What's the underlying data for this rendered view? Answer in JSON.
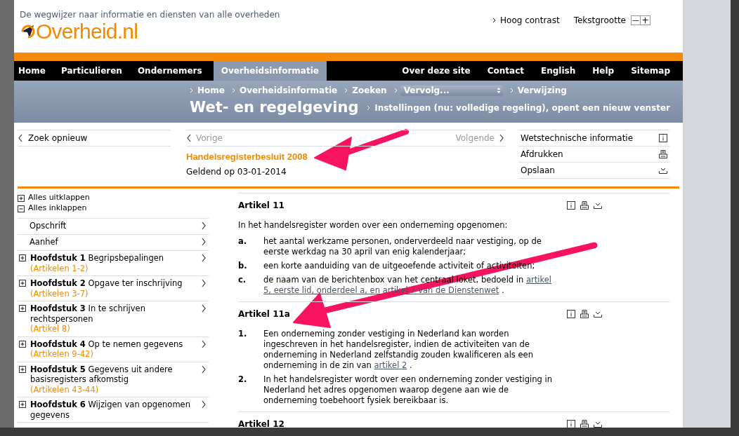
{
  "header": {
    "tagline": "De wegwijzer naar informatie en diensten van alle overheden",
    "logo": "Overheid.nl",
    "high_contrast": "Hoog contrast",
    "text_size": {
      "label": "Tekstgrootte",
      "decrease": "—",
      "increase": "+"
    }
  },
  "nav": {
    "left": [
      {
        "label": "Home",
        "selected": false
      },
      {
        "label": "Particulieren",
        "selected": false
      },
      {
        "label": "Ondernemers",
        "selected": false
      },
      {
        "label": "Overheidsinformatie",
        "selected": true
      }
    ],
    "right": [
      "Over deze site",
      "Contact",
      "English",
      "Help",
      "Sitemap"
    ]
  },
  "breadcrumb": [
    {
      "kind": "link",
      "label": "Home"
    },
    {
      "kind": "link",
      "label": "Overheidsinformatie"
    },
    {
      "kind": "link",
      "label": "Zoeken"
    },
    {
      "kind": "select",
      "label": "Vervolg..."
    },
    {
      "kind": "link",
      "label": "Verwijzing"
    }
  ],
  "section_title": "Wet- en regelgeving",
  "settings_link": "Instellingen (nu: volledige regeling), opent een nieuw venster",
  "search_again": "Zoek opnieuw",
  "pager": {
    "previous": "Vorige",
    "next": "Volgende"
  },
  "document": {
    "title": "Handelsregisterbesluit 2008",
    "valid_on": "Geldend op 03-01-2014"
  },
  "tools": [
    {
      "kind": "info",
      "label": "Wetstechnische informatie"
    },
    {
      "kind": "print",
      "label": "Afdrukken"
    },
    {
      "kind": "save",
      "label": "Opslaan"
    }
  ],
  "toc_controls": [
    {
      "kind": "expand",
      "label": "Alles uitklappen"
    },
    {
      "kind": "collapse",
      "label": "Alles inklappen"
    }
  ],
  "toc": [
    {
      "kind": "plain",
      "title": "Opschrift"
    },
    {
      "kind": "plain",
      "title": "Aanhef"
    },
    {
      "kind": "chapter",
      "number": "Hoofdstuk 1",
      "title": "Begripsbepalingen",
      "articles": "(Artikelen 1-2)"
    },
    {
      "kind": "chapter",
      "number": "Hoofdstuk 2",
      "title": "Opgave ter inschrijving",
      "articles": "(Artikelen 3-7)"
    },
    {
      "kind": "chapter",
      "number": "Hoofdstuk 3",
      "title": "In te schrijven rechtspersonen",
      "articles": "(Artikel 8)"
    },
    {
      "kind": "chapter",
      "number": "Hoofdstuk 4",
      "title": "Op te nemen gegevens",
      "articles": "(Artikelen 9-42)"
    },
    {
      "kind": "chapter",
      "number": "Hoofdstuk 5",
      "title": "Gegevens uit andere basisregisters afkomstig",
      "articles": "(Artikelen 43-44)"
    },
    {
      "kind": "chapter",
      "number": "Hoofdstuk 6",
      "title": "Wijzigen van opgenomen gegevens"
    }
  ],
  "articles": [
    {
      "title": "Artikel 11",
      "intro": "In het handelsregister worden over een onderneming opgenomen:",
      "items": [
        {
          "marker": "a.",
          "parts": [
            {
              "text": "het aantal werkzame personen, onderverdeeld naar vestiging, op de eerste werkdag na 30 april van enig kalenderjaar;",
              "kind": "text"
            }
          ]
        },
        {
          "marker": "b.",
          "parts": [
            {
              "text": "een korte aanduiding van de uitgeoefende activiteit of activiteiten;",
              "kind": "text"
            }
          ]
        },
        {
          "marker": "c.",
          "parts": [
            {
              "text": "de naam van de berichtenbox van het centraal loket, bedoeld in ",
              "kind": "text"
            },
            {
              "text": "artikel",
              "kind": "link"
            },
            {
              "text": "5, eerste lid, onderdeel a, en artikel 7 van de Dienstenwet",
              "kind": "link"
            },
            {
              "text": ".",
              "kind": "text"
            }
          ]
        }
      ]
    },
    {
      "title": "Artikel 11a",
      "items": [
        {
          "marker": "1.",
          "parts": [
            {
              "text": "Een onderneming zonder vestiging in Nederland kan worden ingeschreven in het handelsregister, indien de activiteiten van de onderneming in Nederland zelfstandig zouden kwalificeren als een onderneming in de zin van ",
              "kind": "text"
            },
            {
              "text": "artikel 2",
              "kind": "link"
            },
            {
              "text": ".",
              "kind": "text"
            }
          ]
        },
        {
          "marker": "2.",
          "parts": [
            {
              "text": "In het handelsregister wordt over een onderneming zonder vestiging in Nederland het adres opgenomen waarop degene aan wie de onderneming toebehoort fysiek bereikbaar is.",
              "kind": "text"
            }
          ]
        }
      ]
    },
    {
      "title": "Artikel 12"
    }
  ]
}
